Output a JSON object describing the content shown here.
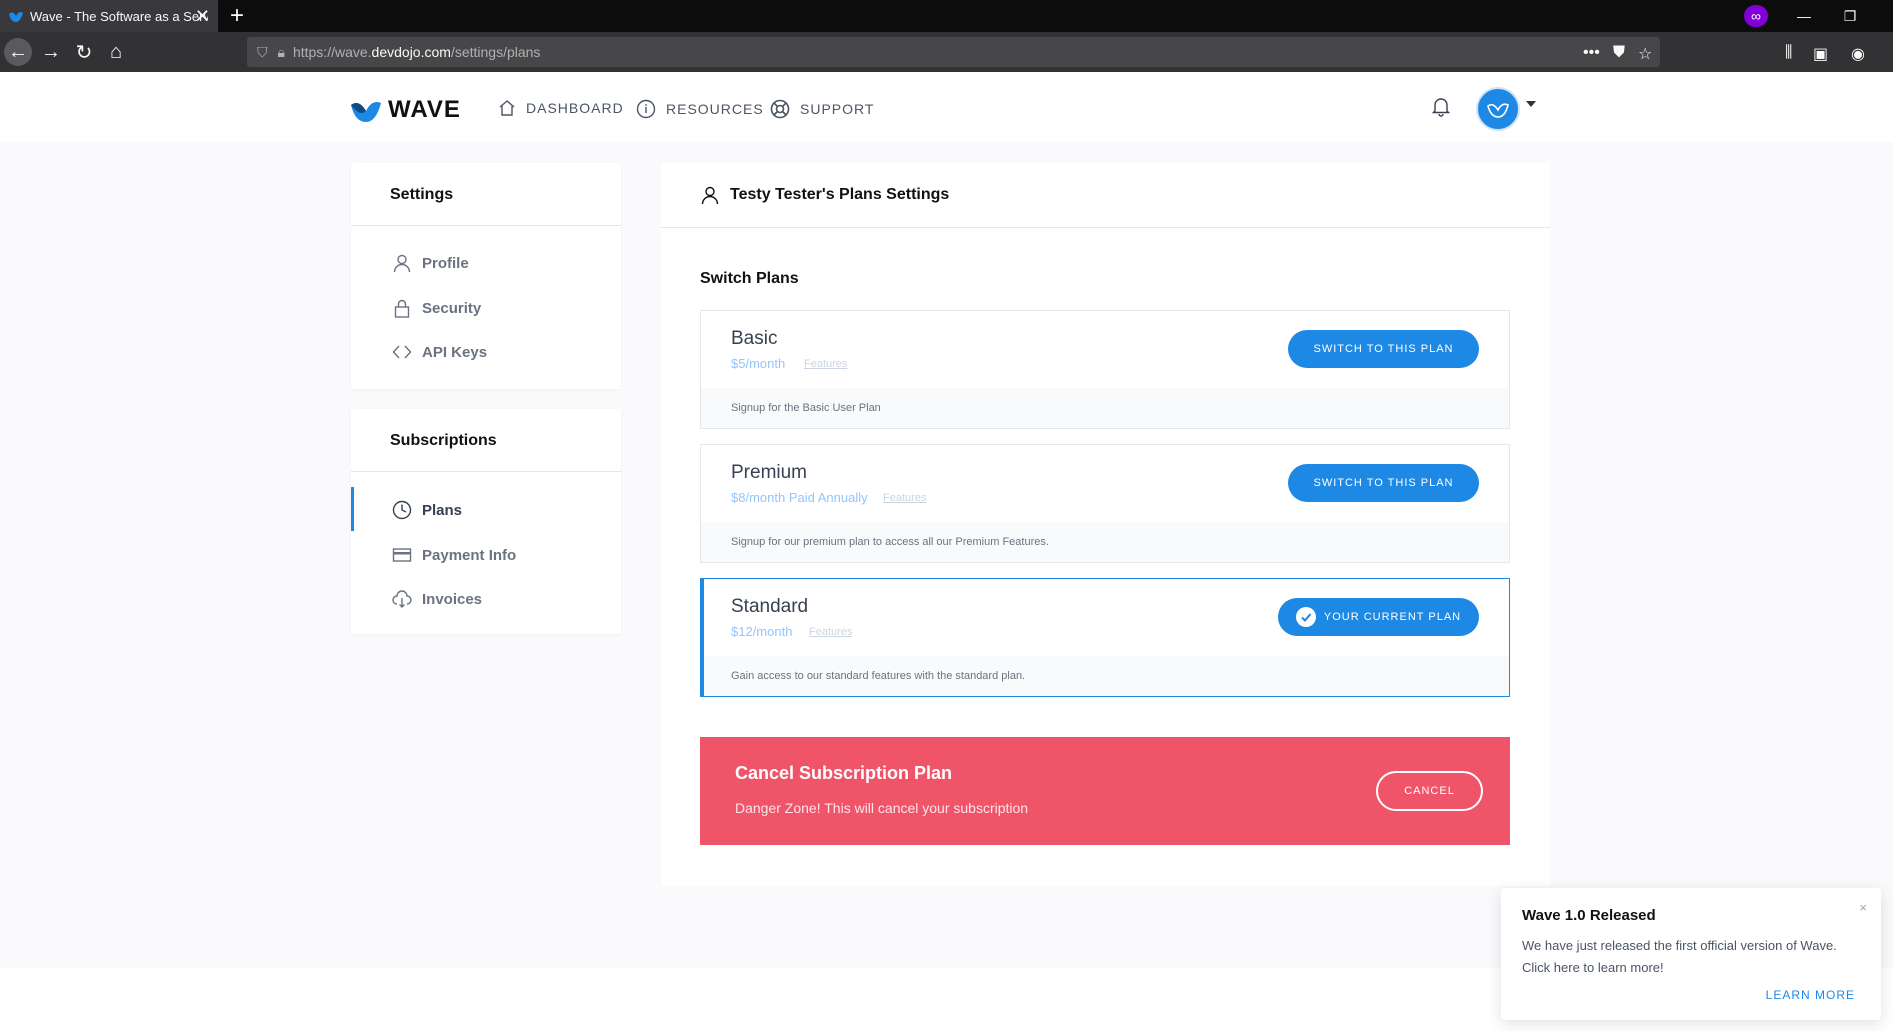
{
  "browser": {
    "tab_title": "Wave - The Software as a Service",
    "url_prefix": "https://wave.",
    "url_host": "devdojo.com",
    "url_path": "/settings/plans",
    "url_more": "•••"
  },
  "app": {
    "logo_text": "WAVE",
    "nav": {
      "dashboard": "DASHBOARD",
      "resources": "RESOURCES",
      "support": "SUPPORT"
    }
  },
  "sidebar": {
    "settings_title": "Settings",
    "settings_items": [
      "Profile",
      "Security",
      "API Keys"
    ],
    "subscriptions_title": "Subscriptions",
    "subscription_items": [
      "Plans",
      "Payment Info",
      "Invoices"
    ]
  },
  "main": {
    "title": "Testy Tester's Plans Settings",
    "section_title": "Switch Plans",
    "plans": [
      {
        "name": "Basic",
        "price": "$5/month",
        "features": "Features",
        "description": "Signup for the Basic User Plan",
        "button": "SWITCH TO THIS PLAN"
      },
      {
        "name": "Premium",
        "price": "$8/month Paid Annually",
        "features": "Features",
        "description": "Signup for our premium plan to access all our Premium Features.",
        "button": "SWITCH TO THIS PLAN"
      },
      {
        "name": "Standard",
        "price": "$12/month",
        "features": "Features",
        "description": "Gain access to our standard features with the standard plan.",
        "button": "YOUR CURRENT PLAN"
      }
    ],
    "danger": {
      "title": "Cancel Subscription Plan",
      "text": "Danger Zone! This will cancel your subscription",
      "button": "CANCEL"
    }
  },
  "toast": {
    "title": "Wave 1.0 Released",
    "close": "×",
    "text": "We have just released the first official version of Wave. Click here to learn more!",
    "link": "LEARN MORE"
  },
  "colors": {
    "accent": "#1e88e5",
    "danger": "#ef5469"
  }
}
